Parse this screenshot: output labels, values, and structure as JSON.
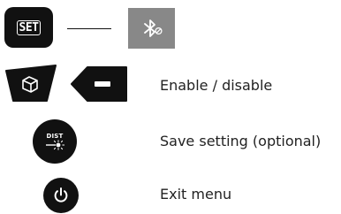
{
  "keys": {
    "set_label": "SET",
    "dist_label": "DIST"
  },
  "icons": {
    "bluetooth_off": "bluetooth-off-icon",
    "cube": "cube-icon",
    "minus": "minus-icon",
    "laser": "laser-icon",
    "power": "power-icon"
  },
  "rows": {
    "enable_disable": "Enable / disable",
    "save_setting": "Save setting (optional)",
    "exit_menu": "Exit menu"
  },
  "colors": {
    "key_background": "#111111",
    "bluetooth_box": "#888888",
    "text": "#222222"
  }
}
